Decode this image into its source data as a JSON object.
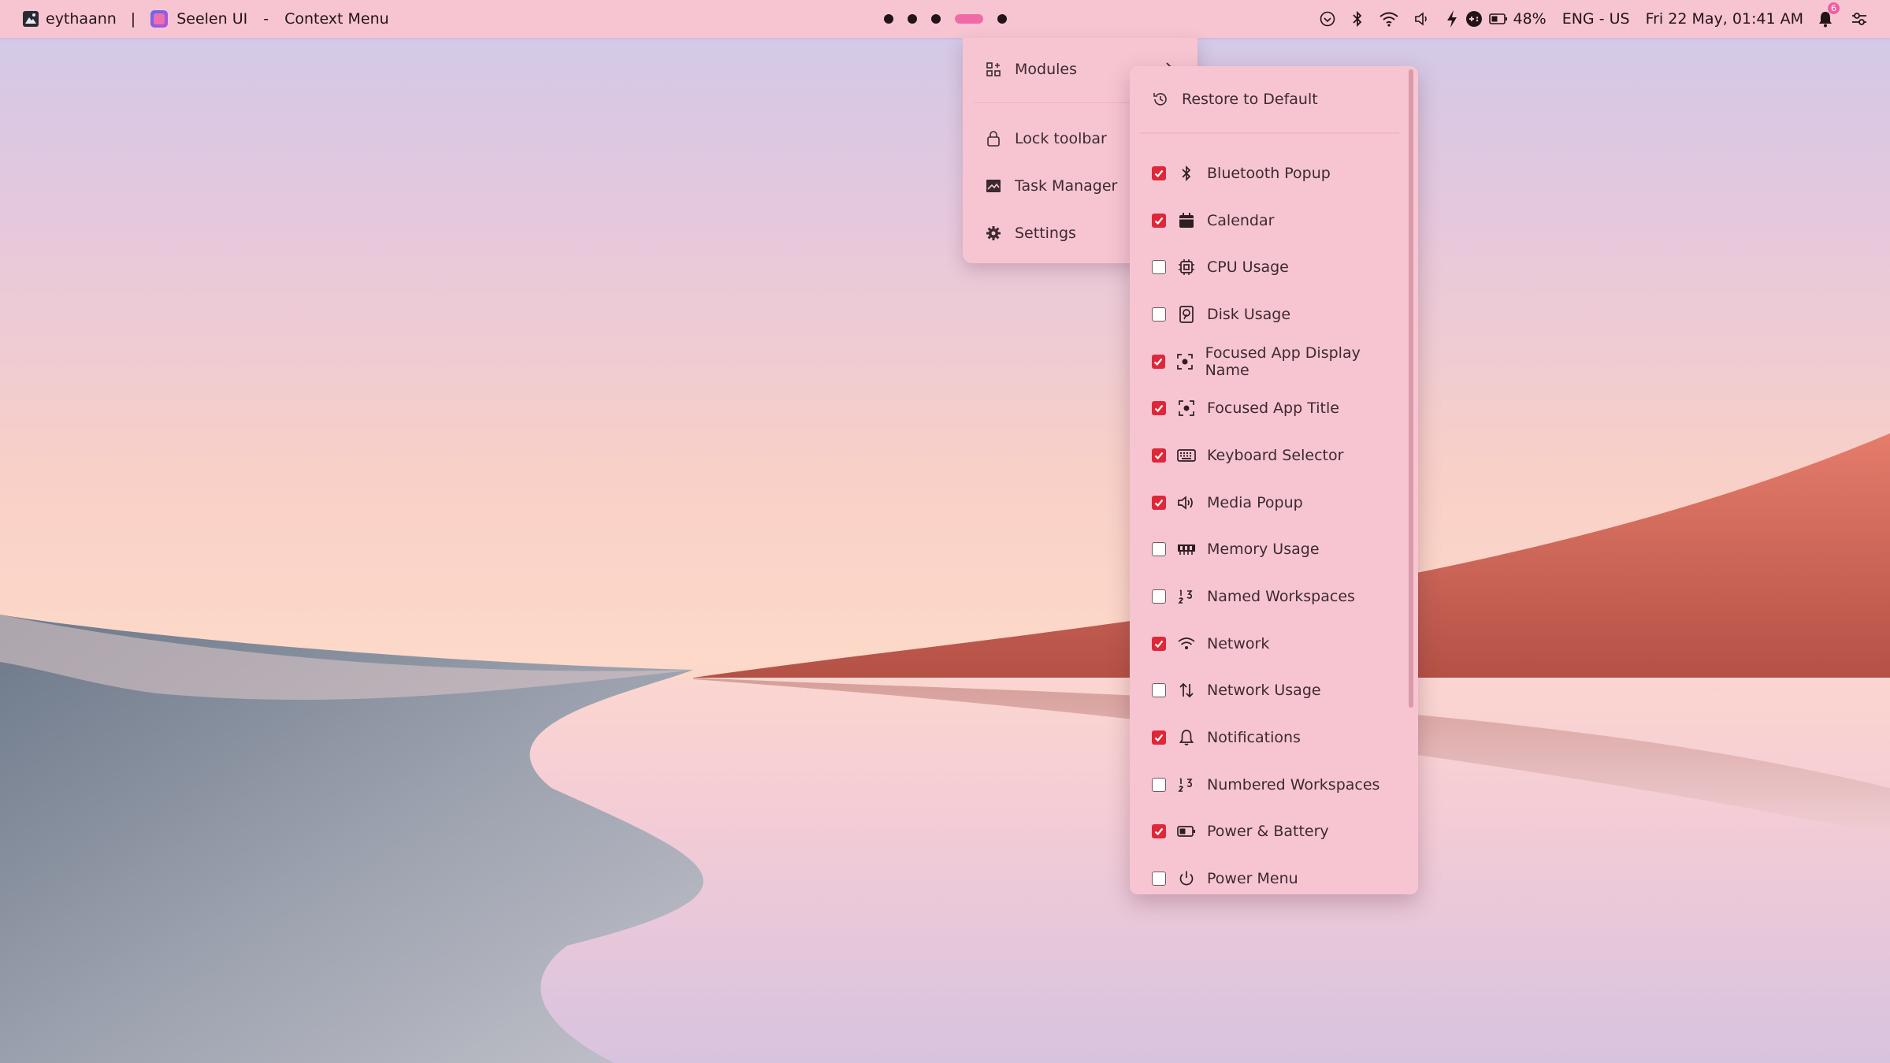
{
  "colors": {
    "bar_bg": "#f7c5d2",
    "accent": "#f06aa8",
    "checkbox_on": "#de2739"
  },
  "topbar": {
    "user_name": "eythaann",
    "divider": "|",
    "app_name": "Seelen UI",
    "title_sep": "-",
    "window_title": "Context Menu",
    "battery_percent": "48%",
    "keyboard": "ENG - US",
    "datetime": "Fri 22 May, 01:41 AM",
    "notification_count": "6",
    "icons": [
      "media-icon",
      "bluetooth-icon",
      "wifi-icon",
      "volume-icon",
      "charging-icon",
      "gamepad-icon",
      "battery-icon",
      "bell-icon",
      "settings-toggle-icon"
    ],
    "workspaces": {
      "count": 5,
      "active_index": 3
    }
  },
  "menu": {
    "items": [
      {
        "label": "Modules",
        "icon": "grid-add-icon"
      },
      {
        "label": "Lock toolbar",
        "icon": "lock-icon"
      },
      {
        "label": "Task Manager",
        "icon": "chart-image-icon"
      },
      {
        "label": "Settings",
        "icon": "gear-icon"
      }
    ]
  },
  "submenu": {
    "restore_label": "Restore to Default",
    "modules": [
      {
        "label": "Bluetooth Popup",
        "checked": true,
        "icon": "bluetooth-icon"
      },
      {
        "label": "Calendar",
        "checked": true,
        "icon": "calendar-icon"
      },
      {
        "label": "CPU Usage",
        "checked": false,
        "icon": "cpu-icon"
      },
      {
        "label": "Disk Usage",
        "checked": false,
        "icon": "disk-icon"
      },
      {
        "label": "Focused App Display Name",
        "checked": true,
        "icon": "focus-icon"
      },
      {
        "label": "Focused App Title",
        "checked": true,
        "icon": "focus-icon"
      },
      {
        "label": "Keyboard Selector",
        "checked": true,
        "icon": "keyboard-icon"
      },
      {
        "label": "Media Popup",
        "checked": true,
        "icon": "speaker-icon"
      },
      {
        "label": "Memory Usage",
        "checked": false,
        "icon": "memory-icon"
      },
      {
        "label": "Named Workspaces",
        "checked": false,
        "icon": "workspaces-icon"
      },
      {
        "label": "Network",
        "checked": true,
        "icon": "wifi-icon"
      },
      {
        "label": "Network Usage",
        "checked": false,
        "icon": "up-down-arrows-icon"
      },
      {
        "label": "Notifications",
        "checked": true,
        "icon": "bell-icon"
      },
      {
        "label": "Numbered Workspaces",
        "checked": false,
        "icon": "workspaces-icon"
      },
      {
        "label": "Power & Battery",
        "checked": true,
        "icon": "battery-icon"
      },
      {
        "label": "Power Menu",
        "checked": false,
        "icon": "power-icon"
      }
    ]
  }
}
